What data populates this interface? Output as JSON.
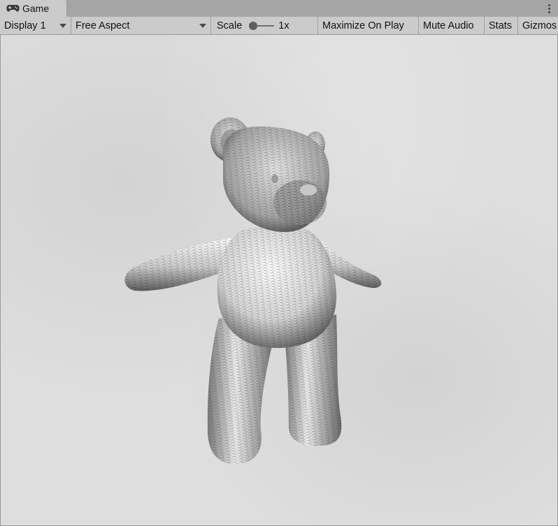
{
  "tab": {
    "label": "Game",
    "icon": "gamepad-icon"
  },
  "toolbar": {
    "display": "Display 1",
    "aspect": "Free Aspect",
    "scale_label": "Scale",
    "scale_value": "1x",
    "maximize": "Maximize On Play",
    "mute": "Mute Audio",
    "stats": "Stats",
    "gizmos": "Gizmos"
  },
  "scene": {
    "subject": "teddy-bear-model"
  }
}
